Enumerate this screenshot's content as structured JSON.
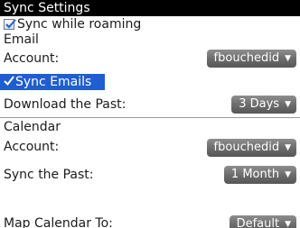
{
  "title": "Sync Settings",
  "sync_roaming": {
    "label": "Sync while roaming",
    "checked": true
  },
  "email": {
    "section_label": "Email",
    "account_label": "Account:",
    "account_value": "fbouchedid",
    "sync_emails": {
      "label": "Sync Emails",
      "checked": true,
      "focused": true
    },
    "download_label": "Download the Past:",
    "download_value": "3 Days"
  },
  "calendar": {
    "section_label": "Calendar",
    "account_label": "Account:",
    "account_value": "fbouchedid",
    "sync_past_label": "Sync the Past:",
    "sync_past_value": "1 Month",
    "map_label": "Map Calendar To:",
    "map_value": "Default"
  },
  "colors": {
    "title_bar": "#000000",
    "focus_highlight": "#1c5fd0",
    "dropdown": "#6a6a6a"
  }
}
